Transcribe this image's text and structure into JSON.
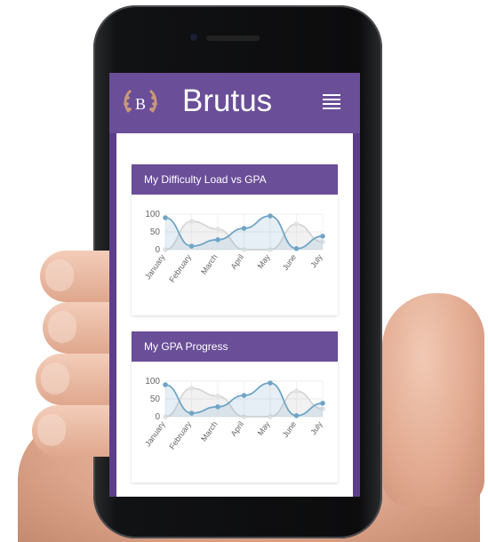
{
  "app": {
    "brand": "Brutus",
    "logo_letter": "B",
    "menu_icon": "hamburger-menu-icon"
  },
  "colors": {
    "accent": "#6a4e97",
    "series_a": "#6fa5c7",
    "series_b": "#d6d6d6"
  },
  "cards": [
    {
      "title": "My Difficulty Load vs GPA"
    },
    {
      "title": "My GPA Progress"
    }
  ],
  "chart_data": [
    {
      "type": "line",
      "categories": [
        "January",
        "February",
        "March",
        "April",
        "May",
        "June",
        "July"
      ],
      "ylim": [
        0,
        100
      ],
      "yticks": [
        0,
        50,
        100
      ],
      "series": [
        {
          "values": [
            90,
            10,
            28,
            60,
            95,
            3,
            38
          ]
        },
        {
          "values": [
            0,
            80,
            58,
            0,
            0,
            72,
            22
          ]
        }
      ]
    },
    {
      "type": "line",
      "categories": [
        "January",
        "February",
        "March",
        "April",
        "May",
        "June",
        "July"
      ],
      "ylim": [
        0,
        100
      ],
      "yticks": [
        0,
        50,
        100
      ],
      "series": [
        {
          "values": [
            90,
            10,
            28,
            60,
            95,
            3,
            38
          ]
        },
        {
          "values": [
            0,
            80,
            58,
            0,
            0,
            72,
            22
          ]
        }
      ]
    }
  ]
}
